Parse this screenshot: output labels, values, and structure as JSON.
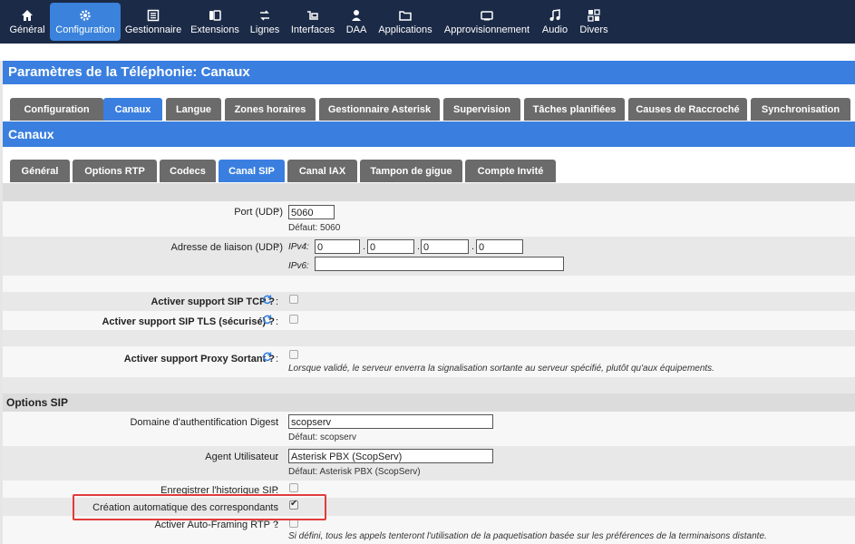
{
  "topnav": {
    "items": [
      {
        "label": "Général",
        "icon": "home-icon"
      },
      {
        "label": "Configuration",
        "icon": "gear-icon",
        "active": true
      },
      {
        "label": "Gestionnaire",
        "icon": "list-icon"
      },
      {
        "label": "Extensions",
        "icon": "phones-icon"
      },
      {
        "label": "Lignes",
        "icon": "arrows-icon"
      },
      {
        "label": "Interfaces",
        "icon": "network-icon"
      },
      {
        "label": "DAA",
        "icon": "person-icon"
      },
      {
        "label": "Applications",
        "icon": "folder-icon"
      },
      {
        "label": "Approvisionnement",
        "icon": "device-icon"
      },
      {
        "label": "Audio",
        "icon": "music-icon"
      },
      {
        "label": "Divers",
        "icon": "grid-icon"
      }
    ]
  },
  "page_title": "Paramètres de la Téléphonie:  Canaux",
  "tabs1": [
    "Configuration",
    "Canaux",
    "Langue",
    "Zones horaires",
    "Gestionnaire Asterisk",
    "Supervision",
    "Tâches planifiées",
    "Causes de Raccroché",
    "Synchronisation"
  ],
  "section_title": "Canaux",
  "tabs2": [
    "Général",
    "Options RTP",
    "Codecs",
    "Canal SIP",
    "Canal IAX",
    "Tampon de gigue",
    "Compte Invité"
  ],
  "form": {
    "port_label": "Port (UDP)",
    "port_value": "5060",
    "port_default": "Défaut: 5060",
    "bind_label": "Adresse de liaison (UDP)",
    "ipv4_label": "IPv4:",
    "ipv4_values": [
      "0",
      "0",
      "0",
      "0"
    ],
    "ipv6_label": "IPv6:",
    "ipv6_value": "",
    "tcp_label": "Activer support SIP TCP ?",
    "tls_label": "Activer support SIP TLS (sécurisé) ?",
    "proxy_label": "Activer support Proxy Sortant ?",
    "proxy_hint": "Lorsque validé, le serveur enverra la signalisation sortante au serveur spécifié, plutôt qu'aux équipements.",
    "options_title": "Options SIP",
    "digest_label": "Domaine d'authentification Digest",
    "digest_value": "scopserv",
    "digest_default": "Défaut: scopserv",
    "ua_label": "Agent Utilisateur",
    "ua_value": "Asterisk PBX (ScopServ)",
    "ua_default": "Défaut: Asterisk PBX (ScopServ)",
    "history_label": "Enregistrer l'historique SIP",
    "autocreate_label": "Création automatique des correspondants",
    "autoframing_label": "Activer Auto-Framing RTP ?",
    "autoframing_hint": "Si défini, tous les appels tenteront l'utilisation de la paquetisation basée sur les préférences de la terminaisons distante.",
    "colon": ":"
  }
}
